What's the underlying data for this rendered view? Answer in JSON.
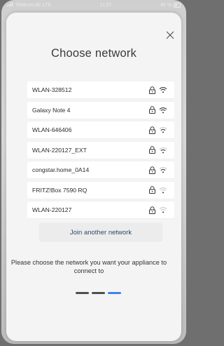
{
  "status_bar": {
    "carrier": "Telekom.de",
    "network": "LTE",
    "time": "11:57",
    "battery": "46 %"
  },
  "dialog": {
    "title": "Choose network",
    "join_label": "Join another network",
    "description": "Please choose the network you want your appliance to connect to"
  },
  "networks": [
    {
      "name": "WLAN-328512",
      "locked": true,
      "signal": 3
    },
    {
      "name": "Galaxy Note 4",
      "locked": true,
      "signal": 3
    },
    {
      "name": "WLAN-646406",
      "locked": true,
      "signal": 2
    },
    {
      "name": "WLAN-220127_EXT",
      "locked": true,
      "signal": 2
    },
    {
      "name": "congstar.home_0A14",
      "locked": true,
      "signal": 2
    },
    {
      "name": "FRITZ!Box 7590 RQ",
      "locked": true,
      "signal": 1
    },
    {
      "name": "WLAN-220127",
      "locked": true,
      "signal": 1
    }
  ],
  "pager": {
    "pages": 3,
    "active_page": 3,
    "inactive_color": "#4f4f4f",
    "active_color": "#3d86e6"
  },
  "colors": {
    "accent": "#2c4a6b",
    "icon": "#333333"
  }
}
